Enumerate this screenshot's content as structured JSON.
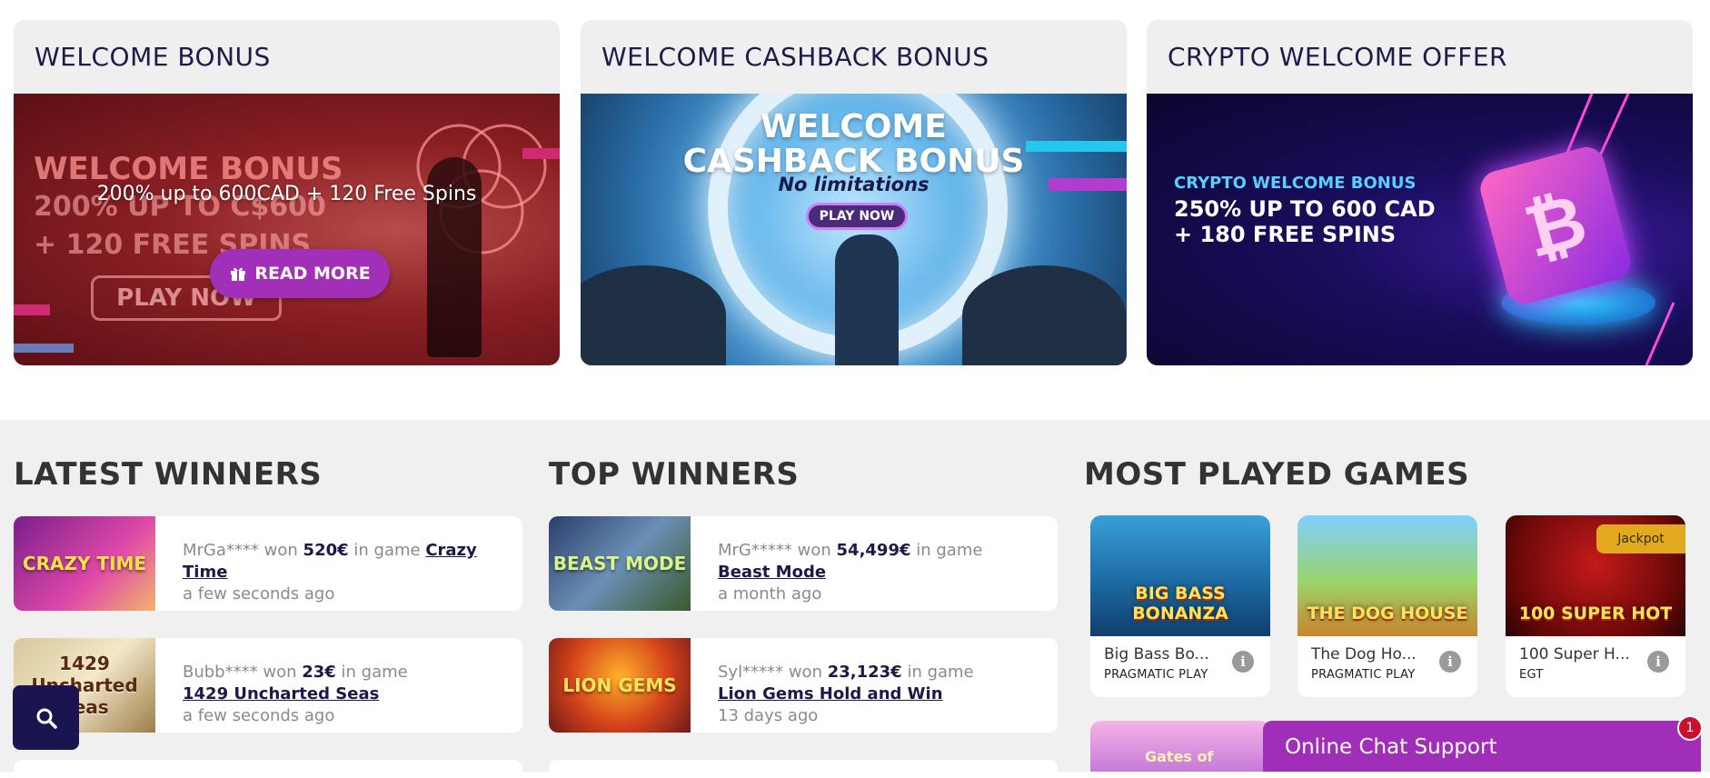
{
  "promos": [
    {
      "title": "WELCOME BONUS",
      "banner_heading": "WELCOME BONUS",
      "banner_sub": "200% UP TO C$600\n+ 120 FREE SPINS",
      "overlay_text": "200% up to 600CAD + 120 Free Spins",
      "read_more_label": "READ MORE",
      "play_label": "PLAY NOW"
    },
    {
      "title": "WELCOME CASHBACK BONUS",
      "banner_line1": "WELCOME",
      "banner_line2": "CASHBACK BONUS",
      "banner_sub": "No limitations",
      "play_label": "PLAY NOW"
    },
    {
      "title": "CRYPTO WELCOME OFFER",
      "banner_small": "CRYPTO WELCOME BONUS",
      "banner_line1": "250% UP TO 600 CAD",
      "banner_line2": "+ 180 FREE SPINS",
      "coin_glyph": "₿"
    }
  ],
  "latest_winners": {
    "title": "LATEST WINNERS",
    "items": [
      {
        "user": "MrGa****",
        "won_word": "won",
        "amount": "520€",
        "in_game": "in game",
        "game": "Crazy Time",
        "time": "a few seconds ago",
        "thumb_text": "CRAZY TIME"
      },
      {
        "user": "Bubb****",
        "won_word": "won",
        "amount": "23€",
        "in_game": "in game",
        "game": "1429 Uncharted Seas",
        "time": "a few seconds ago",
        "thumb_text": "1429 Uncharted Seas"
      }
    ]
  },
  "top_winners": {
    "title": "TOP WINNERS",
    "items": [
      {
        "user": "MrG*****",
        "won_word": "won",
        "amount": "54,499€",
        "in_game": "in game",
        "game": "Beast Mode",
        "time": "a month ago",
        "thumb_text": "BEAST MODE"
      },
      {
        "user": "Syl*****",
        "won_word": "won",
        "amount": "23,123€",
        "in_game": "in game",
        "game": "Lion Gems Hold and Win",
        "time": "13 days ago",
        "thumb_text": "LION GEMS"
      }
    ]
  },
  "most_played": {
    "title": "MOST PLAYED GAMES",
    "games": [
      {
        "name": "Big Bass Bo...",
        "provider": "PRAGMATIC PLAY",
        "art_text": "BIG BASS BONANZA"
      },
      {
        "name": "The Dog Ho...",
        "provider": "PRAGMATIC PLAY",
        "art_text": "THE DOG HOUSE"
      },
      {
        "name": "100 Super H...",
        "provider": "EGT",
        "art_text": "100 SUPER HOT",
        "badge": "Jackpot"
      }
    ],
    "next_art_text": "Gates of"
  },
  "info_glyph": "i",
  "chat": {
    "label": "Online Chat Support",
    "badge": "1"
  },
  "colors": {
    "accent": "#a22fb8",
    "navy": "#1a1450",
    "jackpot": "#e2a91e"
  }
}
